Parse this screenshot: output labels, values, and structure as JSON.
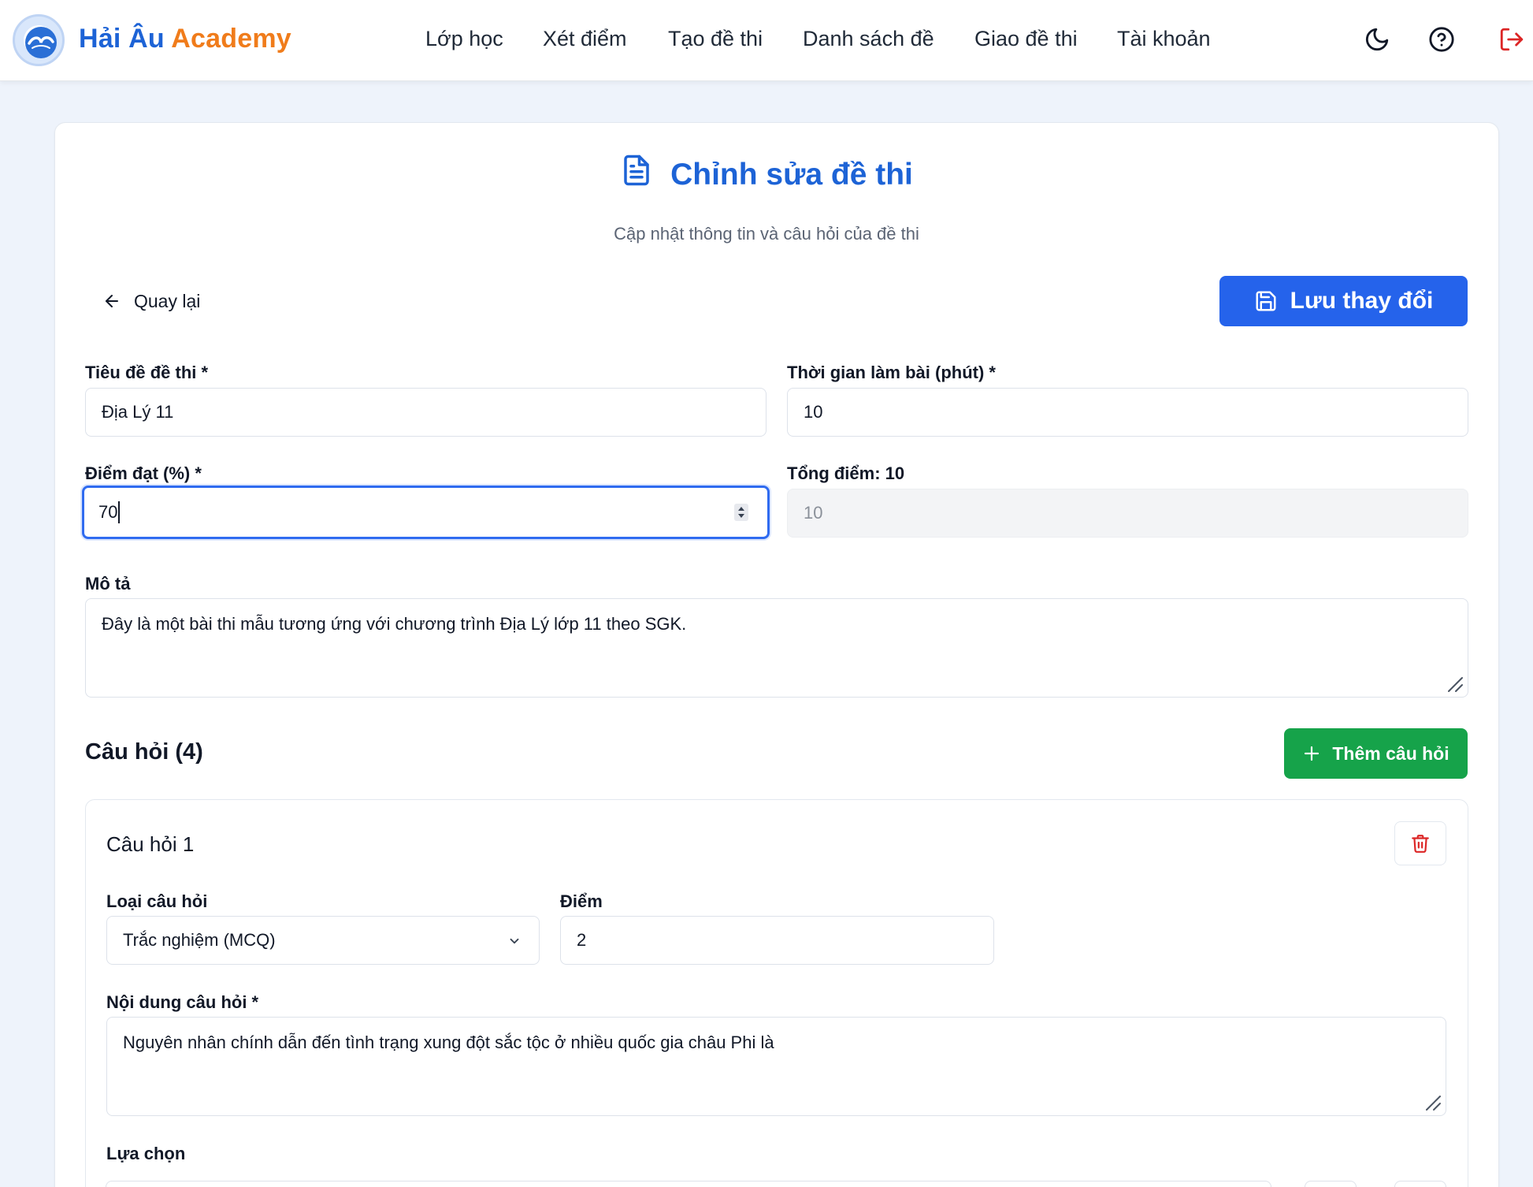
{
  "header": {
    "brand_part1": "Hải Âu",
    "brand_part2": "Academy",
    "nav": [
      {
        "label": "Lớp học"
      },
      {
        "label": "Xét điểm"
      },
      {
        "label": "Tạo đề thi"
      },
      {
        "label": "Danh sách đề"
      },
      {
        "label": "Giao đề thi"
      },
      {
        "label": "Tài khoản"
      }
    ],
    "icons": [
      "moon-icon",
      "help-circle-icon",
      "logout-icon"
    ]
  },
  "page": {
    "title": "Chỉnh sửa đề thi",
    "subtitle": "Cập nhật thông tin và câu hỏi của đề thi",
    "back_label": "Quay lại",
    "save_label": "Lưu thay đổi"
  },
  "form": {
    "title_label": "Tiêu đề đề thi *",
    "title_value": "Địa Lý 11",
    "duration_label": "Thời gian làm bài (phút) *",
    "duration_value": "10",
    "pass_label": "Điểm đạt (%) *",
    "pass_value": "70",
    "total_label": "Tổng điểm: 10",
    "total_value": "10",
    "description_label": "Mô tả",
    "description_value": "Đây là một bài thi mẫu tương ứng với chương trình Địa Lý lớp 11 theo SGK."
  },
  "questions": {
    "section_title": "Câu hỏi (4)",
    "add_label": "Thêm câu hỏi",
    "items": [
      {
        "title": "Câu hỏi 1",
        "type_label": "Loại câu hỏi",
        "type_value": "Trắc nghiệm (MCQ)",
        "points_label": "Điểm",
        "points_value": "2",
        "content_label": "Nội dung câu hỏi *",
        "content_value": "Nguyên nhân chính dẫn đến tình trạng xung đột sắc tộc ở nhiều quốc gia châu Phi là",
        "options_label": "Lựa chọn"
      }
    ]
  },
  "colors": {
    "primary": "#2563eb",
    "brand_blue": "#1d63d6",
    "brand_orange": "#f07c1b",
    "success": "#16a34a",
    "danger": "#dc2626",
    "page_bg": "#eef3fb"
  }
}
